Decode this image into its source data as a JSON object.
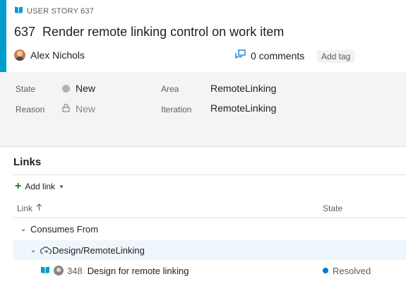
{
  "header": {
    "type_label": "USER STORY 637",
    "id": "637",
    "title": "Render remote linking control on work item",
    "assignee": "Alex Nichols",
    "comments": "0 comments",
    "add_tag": "Add tag",
    "accent_color": "#009ccc"
  },
  "fields": {
    "state_label": "State",
    "state_value": "New",
    "reason_label": "Reason",
    "reason_value": "New",
    "area_label": "Area",
    "area_value": "RemoteLinking",
    "iteration_label": "Iteration",
    "iteration_value": "RemoteLinking"
  },
  "links": {
    "title": "Links",
    "add_link": "Add link",
    "columns": {
      "link": "Link",
      "state": "State"
    },
    "group": "Consumes From",
    "subgroup": "Design/RemoteLinking",
    "items": [
      {
        "id": "348",
        "title": "Design for remote linking",
        "state": "Resolved",
        "state_color": "#0078d4"
      }
    ]
  },
  "icons": {
    "type": "book-icon",
    "comments": "comments-icon",
    "reason_lock": "lock-icon",
    "add": "plus-icon",
    "sort": "arrow-up-icon",
    "remote": "cloud-link-icon"
  }
}
